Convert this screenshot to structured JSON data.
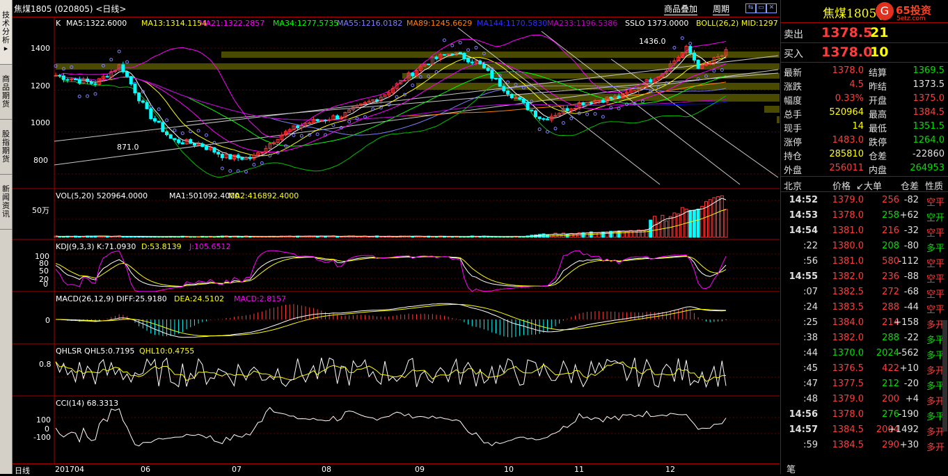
{
  "title_bar": {
    "symbol_title": "焦煤1805 (020805) <日线>",
    "link_overlay": "商品叠加",
    "link_period": "周期"
  },
  "sidebar": {
    "tabs": [
      {
        "label": "技术分析"
      },
      {
        "label": "商品期货"
      },
      {
        "label": "股指期货"
      },
      {
        "label": "新闻资讯"
      }
    ]
  },
  "panels": {
    "main": {
      "label_k": "K",
      "ma5": "MA5:1322.6000",
      "ma13": "MA13:1314.1154",
      "ma21": "MA21:1322.2857",
      "ma34": "MA34:1277.5735",
      "ma55": "MA55:1216.0182",
      "ma89": "MA89:1245.6629",
      "ma144": "MA144:1170.5830",
      "ma233": "MA233:1196.5386",
      "sslo": "SSLO 1373.0000",
      "boll": "BOLL(26,2) MID:1297",
      "y_ticks": [
        "1400",
        "1200",
        "1000",
        "800"
      ],
      "high_label": "1436.0",
      "low_label": "871.0"
    },
    "vol": {
      "label": "VOL(5,20) 520964.0000",
      "ma1": "MA1:501092.4000",
      "ma2": "MA2:416892.4000",
      "y_tick": "50万"
    },
    "kdj": {
      "label": "KDJ(9,3,3) K:71.0930",
      "d": "D:53.8139",
      "j": "J:105.6512",
      "y_ticks": [
        "100",
        "80",
        "50",
        "20",
        "0"
      ]
    },
    "macd": {
      "label": "MACD(26,12,9) DIFF:25.9180",
      "dea": "DEA:24.5102",
      "macd": "MACD:2.8157",
      "y_tick": "0"
    },
    "qhlsr": {
      "label": "QHLSR QHL5:0.7195",
      "qhl10": "QHL10:0.4755",
      "y_tick": "0.8"
    },
    "cci": {
      "label": "CCI(14) 68.3313",
      "y_ticks": [
        "100",
        "0",
        "-100"
      ]
    }
  },
  "x_axis": {
    "label": "日线",
    "ticks": [
      "201704",
      "06",
      "07",
      "08",
      "09",
      "10",
      "11",
      "12"
    ]
  },
  "colors": {
    "up": "#ff3c3c",
    "down": "#00ffff",
    "ma5": "#ffffff",
    "ma13": "#ffff00",
    "ma21": "#ff00ff",
    "ma34": "#00ff00",
    "ma55": "#8080ff",
    "ma89": "#ff8000",
    "ma144": "#0000ff",
    "ma233": "#c000c0"
  },
  "quote": {
    "name": "焦煤1805(j",
    "brand": "65投资",
    "brand_sub": "5etz.com",
    "sell_label": "卖出",
    "sell_price": "1378.5",
    "sell_vol": "21",
    "buy_label": "买入",
    "buy_price": "1378.0",
    "buy_vol": "10",
    "stats": [
      {
        "l1": "最新",
        "v1": "1378.0",
        "l2": "结算",
        "v2": "1369.5"
      },
      {
        "l1": "涨跌",
        "v1": "4.5",
        "l2": "昨结",
        "v2": "1373.5"
      },
      {
        "l1": "幅度",
        "v1": "0.33%",
        "l2": "开盘",
        "v2": "1375.0"
      },
      {
        "l1": "总手",
        "v1": "520964",
        "l2": "最高",
        "v2": "1384.5"
      },
      {
        "l1": "现手",
        "v1": "14",
        "l2": "最低",
        "v2": "1351.5"
      },
      {
        "l1": "涨停",
        "v1": "1483.0",
        "l2": "跌停",
        "v2": "1264.0"
      },
      {
        "l1": "持仓",
        "v1": "285810",
        "l2": "仓差",
        "v2": "-22860"
      },
      {
        "l1": "外盘",
        "v1": "256011",
        "l2": "内盘",
        "v2": "264953"
      }
    ],
    "tick_header": {
      "c1": "北京",
      "c2": "价格",
      "c3": "↙大单",
      "c4": "仓差",
      "c5": "性质"
    },
    "ticks": [
      {
        "t": "14:52",
        "p": "1379.0",
        "v": "256",
        "d": "-82",
        "n": "空平",
        "pc": "red",
        "vc": "red",
        "dc": "wht",
        "nc": "red"
      },
      {
        "t": "14:53",
        "p": "1378.0",
        "v": "258",
        "d": "+62",
        "n": "空开",
        "pc": "red",
        "vc": "grn",
        "dc": "wht",
        "nc": "grn"
      },
      {
        "t": "14:54",
        "p": "1381.0",
        "v": "216",
        "d": "-32",
        "n": "空平",
        "pc": "red",
        "vc": "red",
        "dc": "wht",
        "nc": "red"
      },
      {
        "t": ":22",
        "p": "1380.0",
        "v": "208",
        "d": "-80",
        "n": "多平",
        "pc": "red",
        "vc": "grn",
        "dc": "wht",
        "nc": "grn"
      },
      {
        "t": ":56",
        "p": "1381.0",
        "v": "580",
        "d": "-112",
        "n": "空平",
        "pc": "red",
        "vc": "red",
        "dc": "wht",
        "nc": "red"
      },
      {
        "t": "14:55",
        "p": "1382.0",
        "v": "236",
        "d": "-88",
        "n": "空平",
        "pc": "red",
        "vc": "red",
        "dc": "wht",
        "nc": "red"
      },
      {
        "t": ":07",
        "p": "1382.5",
        "v": "272",
        "d": "-68",
        "n": "空平",
        "pc": "red",
        "vc": "red",
        "dc": "wht",
        "nc": "red"
      },
      {
        "t": ":24",
        "p": "1383.5",
        "v": "288",
        "d": "-44",
        "n": "空平",
        "pc": "red",
        "vc": "red",
        "dc": "wht",
        "nc": "red"
      },
      {
        "t": ":25",
        "p": "1384.0",
        "v": "214",
        "d": "+158",
        "n": "多开",
        "pc": "red",
        "vc": "red",
        "dc": "wht",
        "nc": "red"
      },
      {
        "t": ":38",
        "p": "1382.0",
        "v": "288",
        "d": "-22",
        "n": "多平",
        "pc": "red",
        "vc": "grn",
        "dc": "wht",
        "nc": "grn"
      },
      {
        "t": ":44",
        "p": "1370.0",
        "v": "2024",
        "d": "-562",
        "n": "多平",
        "pc": "grn",
        "vc": "grn",
        "dc": "wht",
        "nc": "grn"
      },
      {
        "t": ":45",
        "p": "1376.5",
        "v": "422",
        "d": "+10",
        "n": "多开",
        "pc": "red",
        "vc": "red",
        "dc": "wht",
        "nc": "red"
      },
      {
        "t": ":47",
        "p": "1377.5",
        "v": "212",
        "d": "-20",
        "n": "多平",
        "pc": "red",
        "vc": "grn",
        "dc": "wht",
        "nc": "grn"
      },
      {
        "t": ":48",
        "p": "1379.0",
        "v": "200",
        "d": "+4",
        "n": "多开",
        "pc": "red",
        "vc": "red",
        "dc": "wht",
        "nc": "red"
      },
      {
        "t": "14:56",
        "p": "1378.0",
        "v": "276",
        "d": "-190",
        "n": "多平",
        "pc": "red",
        "vc": "grn",
        "dc": "wht",
        "nc": "grn"
      },
      {
        "t": "14:57",
        "p": "1384.5",
        "v": "2004",
        "d": "+1492",
        "n": "多开",
        "pc": "red",
        "vc": "red",
        "dc": "wht",
        "nc": "red"
      },
      {
        "t": ":59",
        "p": "1384.5",
        "v": "290",
        "d": "+30",
        "n": "多开",
        "pc": "red",
        "vc": "red",
        "dc": "wht",
        "nc": "red"
      }
    ],
    "footer_label": "笔"
  },
  "chart_data": {
    "type": "candlestick",
    "instrument": "焦煤1805 (020805)",
    "period": "日线",
    "ylim": [
      750,
      1480
    ],
    "x_ticks": [
      "201704",
      "06",
      "07",
      "08",
      "09",
      "10",
      "11",
      "12"
    ],
    "anchors": [
      {
        "date": "2017-04-10",
        "close": 1270
      },
      {
        "date": "2017-04-25",
        "close": 1230
      },
      {
        "date": "2017-05-05",
        "close": 1320
      },
      {
        "date": "2017-05-15",
        "close": 1100
      },
      {
        "date": "2017-05-25",
        "close": 960
      },
      {
        "date": "2017-06-05",
        "close": 940
      },
      {
        "date": "2017-06-15",
        "close": 880
      },
      {
        "date": "2017-06-25",
        "close": 875
      },
      {
        "date": "2017-07-05",
        "close": 980
      },
      {
        "date": "2017-07-15",
        "close": 1040
      },
      {
        "date": "2017-07-30",
        "close": 1080
      },
      {
        "date": "2017-08-15",
        "close": 1180
      },
      {
        "date": "2017-08-31",
        "close": 1330
      },
      {
        "date": "2017-09-10",
        "close": 1380
      },
      {
        "date": "2017-09-20",
        "close": 1330
      },
      {
        "date": "2017-10-01",
        "close": 1200
      },
      {
        "date": "2017-10-15",
        "close": 1060
      },
      {
        "date": "2017-10-30",
        "close": 1140
      },
      {
        "date": "2017-11-15",
        "close": 1170
      },
      {
        "date": "2017-11-30",
        "close": 1280
      },
      {
        "date": "2017-12-10",
        "close": 1400
      },
      {
        "date": "2017-12-15",
        "close": 1300
      },
      {
        "date": "2017-12-25",
        "close": 1378
      }
    ],
    "high": 1436.0,
    "low": 871.0,
    "indicators": {
      "MA5": 1322.6,
      "MA13": 1314.1154,
      "MA21": 1322.2857,
      "MA34": 1277.5735,
      "MA55": 1216.0182,
      "MA89": 1245.6629,
      "MA144": 1170.583,
      "MA233": 1196.5386,
      "SSLO": 1373.0,
      "VOL": 520964,
      "VOL_MA1": 501092.4,
      "VOL_MA2": 416892.4,
      "K": 71.093,
      "D": 53.8139,
      "J": 105.6512,
      "DIFF": 25.918,
      "DEA": 24.5102,
      "MACD": 2.8157,
      "QHL5": 0.7195,
      "QHL10": 0.4755,
      "CCI14": 68.3313
    }
  }
}
